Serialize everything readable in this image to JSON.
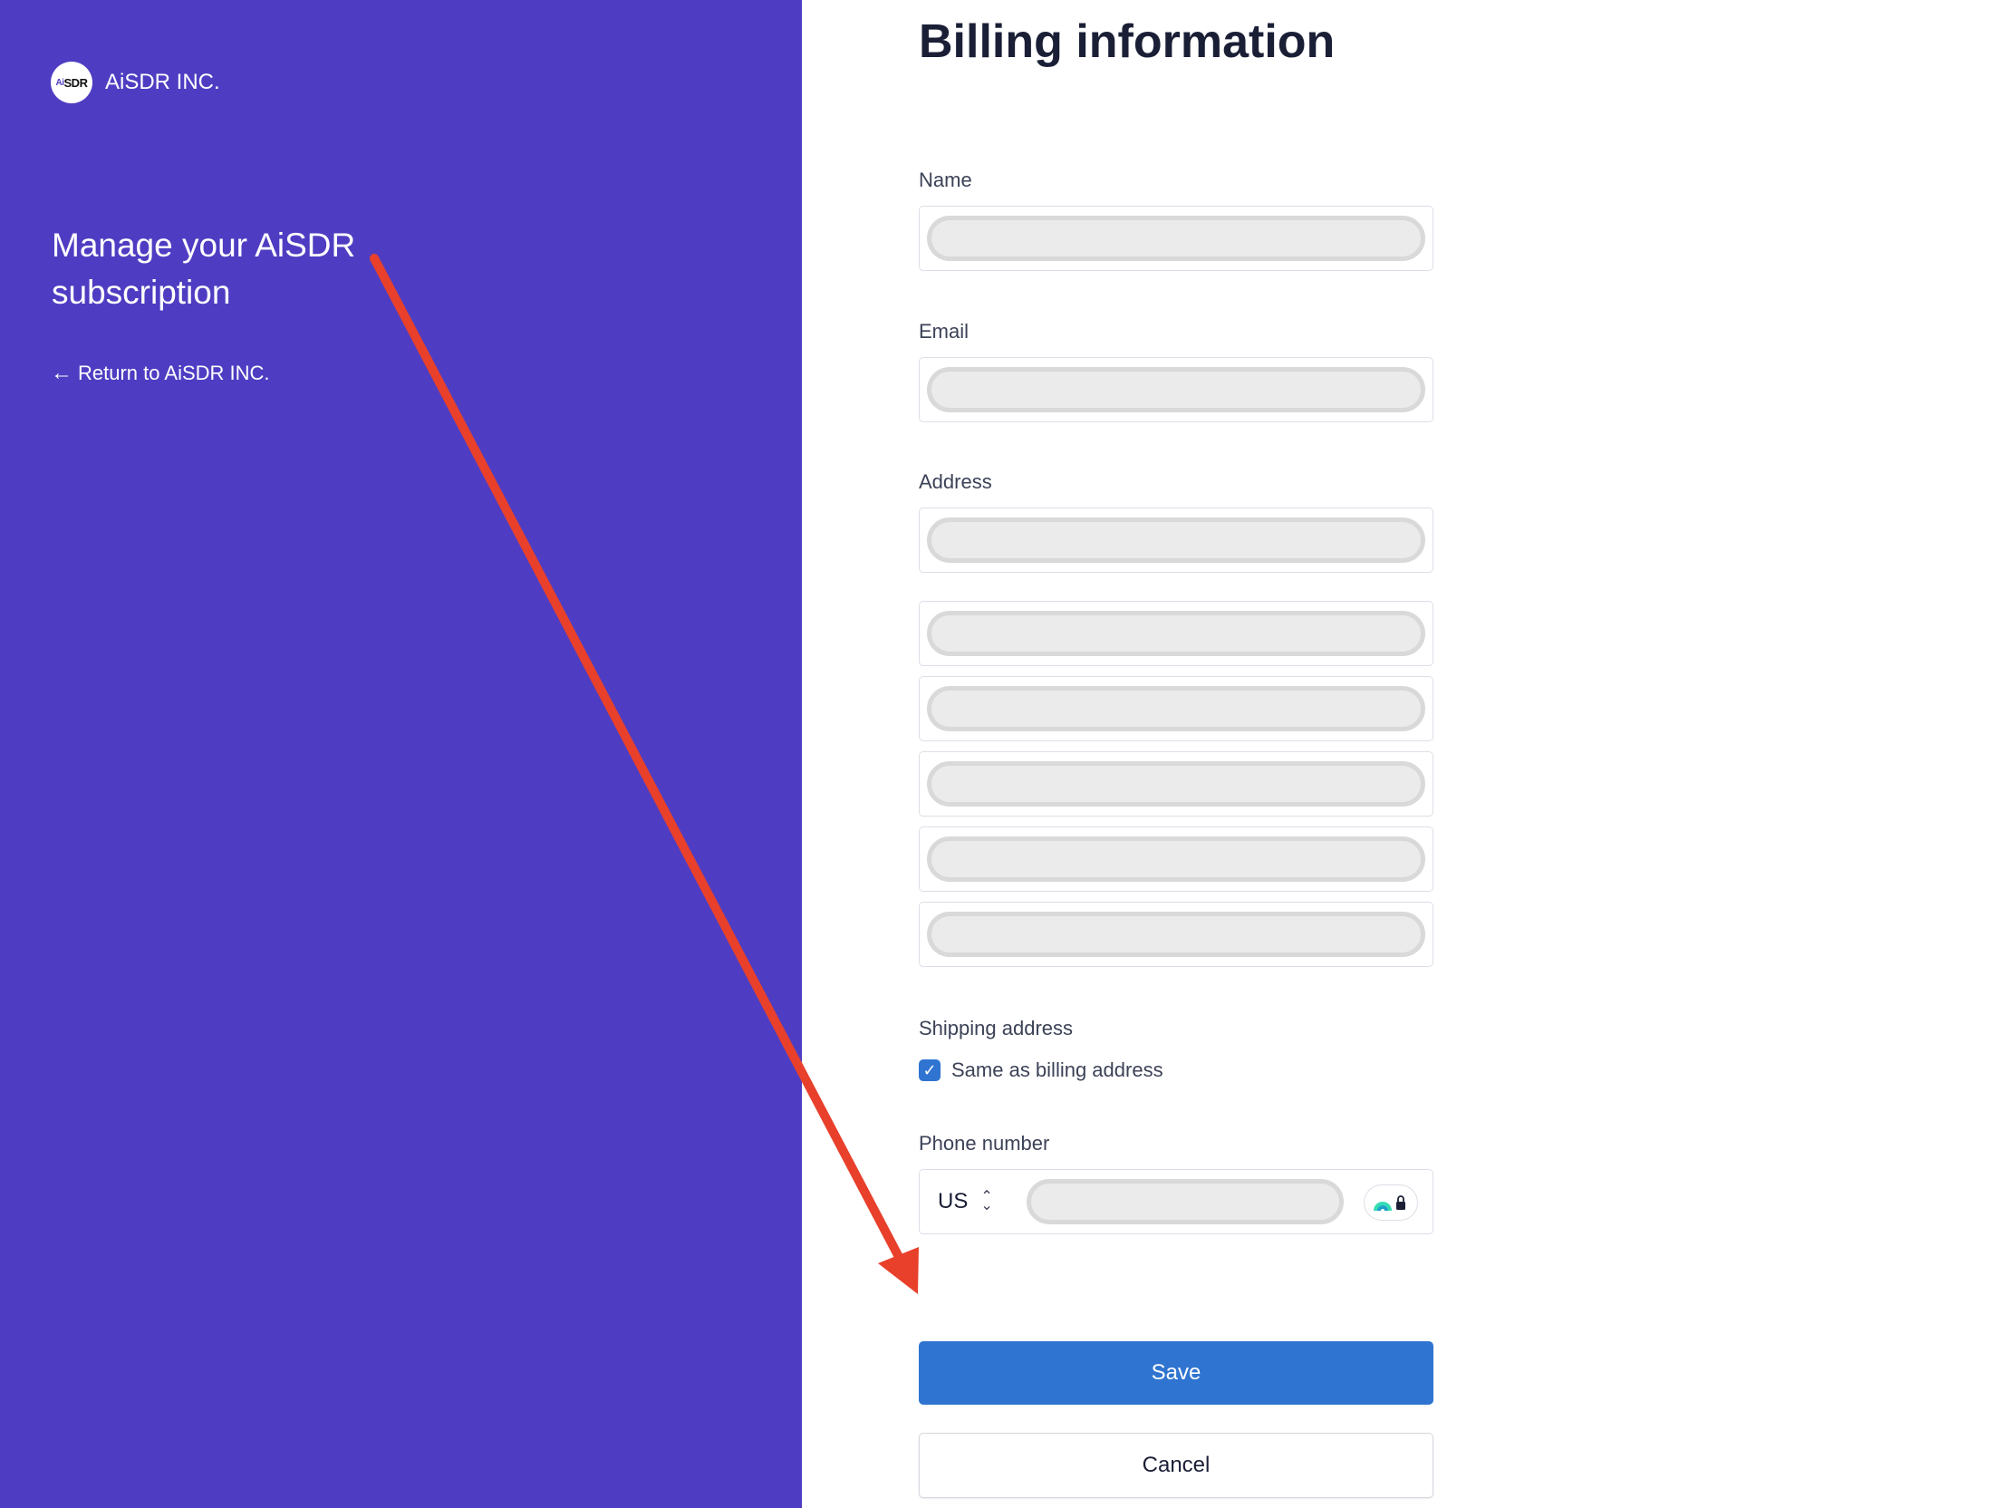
{
  "brand": {
    "logo_text_ai": "Ai",
    "logo_text_sdr": "SDR",
    "name": "AiSDR INC."
  },
  "sidebar": {
    "heading": "Manage your AiSDR subscription",
    "return_link": "Return to AiSDR INC."
  },
  "form": {
    "title": "Billing information",
    "name_label": "Name",
    "email_label": "Email",
    "address_label": "Address",
    "shipping_label": "Shipping address",
    "same_as_billing_label": "Same as billing address",
    "same_as_billing_checked": true,
    "phone_label": "Phone number",
    "phone_country": "US",
    "save_label": "Save",
    "cancel_label": "Cancel"
  },
  "colors": {
    "sidebar_bg": "#4e3dc2",
    "primary_button": "#2f74d0",
    "annotation_arrow": "#e8402b"
  }
}
